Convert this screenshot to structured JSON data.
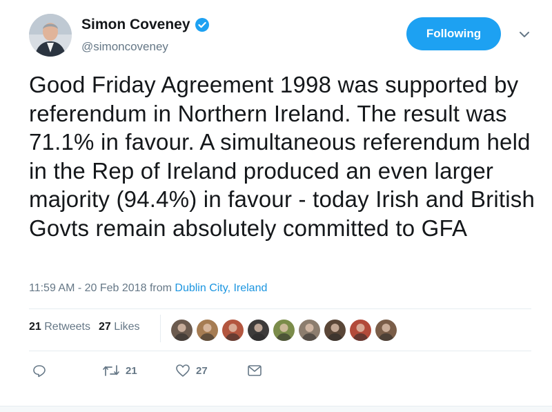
{
  "user": {
    "display_name": "Simon Coveney",
    "handle": "@simoncoveney",
    "verified": true,
    "avatar_icon": "profile-photo"
  },
  "follow_button": {
    "label": "Following"
  },
  "menu": {
    "icon": "chevron-down-icon"
  },
  "tweet": {
    "text": "Good Friday Agreement 1998 was supported by referendum in Northern Ireland. The result was 71.1% in favour. A simultaneous referendum held in the Rep of Ireland produced an even larger majority (94.4%) in favour - today Irish and British Govts remain absolutely committed to GFA"
  },
  "meta": {
    "time": "11:59 AM - 20 Feb 2018",
    "from": "from",
    "location": "Dublin City, Ireland"
  },
  "stats": {
    "retweets_count": "21",
    "retweets_label": "Retweets",
    "likes_count": "27",
    "likes_label": "Likes"
  },
  "likers": [
    {
      "color": "#6b5a4e"
    },
    {
      "color": "#a67c52"
    },
    {
      "color": "#b3563f"
    },
    {
      "color": "#3d3b3a"
    },
    {
      "color": "#7b8c4a"
    },
    {
      "color": "#8c7d6e"
    },
    {
      "color": "#5a4637"
    },
    {
      "color": "#b24a3a"
    },
    {
      "color": "#7a5d48"
    }
  ],
  "actions": {
    "reply_icon": "reply-icon",
    "retweet_icon": "retweet-icon",
    "retweet_count": "21",
    "like_icon": "heart-icon",
    "like_count": "27",
    "dm_icon": "envelope-icon"
  },
  "colors": {
    "accent": "#1da1f2",
    "link": "#1b95e0",
    "muted": "#657786"
  }
}
